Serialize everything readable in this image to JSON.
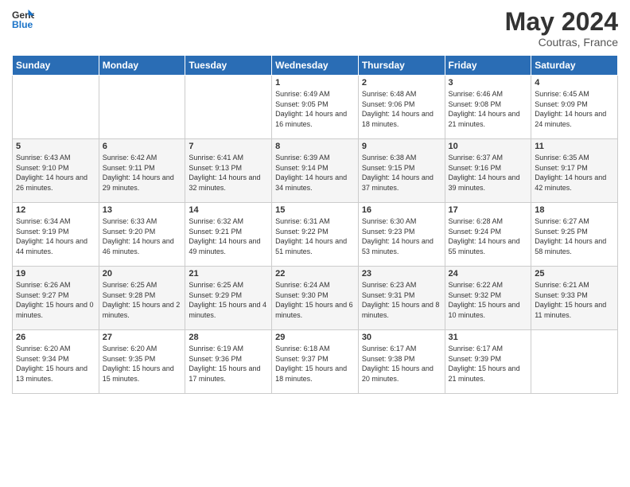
{
  "header": {
    "logo_line1": "General",
    "logo_line2": "Blue",
    "month_year": "May 2024",
    "location": "Coutras, France"
  },
  "days_of_week": [
    "Sunday",
    "Monday",
    "Tuesday",
    "Wednesday",
    "Thursday",
    "Friday",
    "Saturday"
  ],
  "weeks": [
    [
      {
        "day": "",
        "text": ""
      },
      {
        "day": "",
        "text": ""
      },
      {
        "day": "",
        "text": ""
      },
      {
        "day": "1",
        "text": "Sunrise: 6:49 AM\nSunset: 9:05 PM\nDaylight: 14 hours\nand 16 minutes."
      },
      {
        "day": "2",
        "text": "Sunrise: 6:48 AM\nSunset: 9:06 PM\nDaylight: 14 hours\nand 18 minutes."
      },
      {
        "day": "3",
        "text": "Sunrise: 6:46 AM\nSunset: 9:08 PM\nDaylight: 14 hours\nand 21 minutes."
      },
      {
        "day": "4",
        "text": "Sunrise: 6:45 AM\nSunset: 9:09 PM\nDaylight: 14 hours\nand 24 minutes."
      }
    ],
    [
      {
        "day": "5",
        "text": "Sunrise: 6:43 AM\nSunset: 9:10 PM\nDaylight: 14 hours\nand 26 minutes."
      },
      {
        "day": "6",
        "text": "Sunrise: 6:42 AM\nSunset: 9:11 PM\nDaylight: 14 hours\nand 29 minutes."
      },
      {
        "day": "7",
        "text": "Sunrise: 6:41 AM\nSunset: 9:13 PM\nDaylight: 14 hours\nand 32 minutes."
      },
      {
        "day": "8",
        "text": "Sunrise: 6:39 AM\nSunset: 9:14 PM\nDaylight: 14 hours\nand 34 minutes."
      },
      {
        "day": "9",
        "text": "Sunrise: 6:38 AM\nSunset: 9:15 PM\nDaylight: 14 hours\nand 37 minutes."
      },
      {
        "day": "10",
        "text": "Sunrise: 6:37 AM\nSunset: 9:16 PM\nDaylight: 14 hours\nand 39 minutes."
      },
      {
        "day": "11",
        "text": "Sunrise: 6:35 AM\nSunset: 9:17 PM\nDaylight: 14 hours\nand 42 minutes."
      }
    ],
    [
      {
        "day": "12",
        "text": "Sunrise: 6:34 AM\nSunset: 9:19 PM\nDaylight: 14 hours\nand 44 minutes."
      },
      {
        "day": "13",
        "text": "Sunrise: 6:33 AM\nSunset: 9:20 PM\nDaylight: 14 hours\nand 46 minutes."
      },
      {
        "day": "14",
        "text": "Sunrise: 6:32 AM\nSunset: 9:21 PM\nDaylight: 14 hours\nand 49 minutes."
      },
      {
        "day": "15",
        "text": "Sunrise: 6:31 AM\nSunset: 9:22 PM\nDaylight: 14 hours\nand 51 minutes."
      },
      {
        "day": "16",
        "text": "Sunrise: 6:30 AM\nSunset: 9:23 PM\nDaylight: 14 hours\nand 53 minutes."
      },
      {
        "day": "17",
        "text": "Sunrise: 6:28 AM\nSunset: 9:24 PM\nDaylight: 14 hours\nand 55 minutes."
      },
      {
        "day": "18",
        "text": "Sunrise: 6:27 AM\nSunset: 9:25 PM\nDaylight: 14 hours\nand 58 minutes."
      }
    ],
    [
      {
        "day": "19",
        "text": "Sunrise: 6:26 AM\nSunset: 9:27 PM\nDaylight: 15 hours\nand 0 minutes."
      },
      {
        "day": "20",
        "text": "Sunrise: 6:25 AM\nSunset: 9:28 PM\nDaylight: 15 hours\nand 2 minutes."
      },
      {
        "day": "21",
        "text": "Sunrise: 6:25 AM\nSunset: 9:29 PM\nDaylight: 15 hours\nand 4 minutes."
      },
      {
        "day": "22",
        "text": "Sunrise: 6:24 AM\nSunset: 9:30 PM\nDaylight: 15 hours\nand 6 minutes."
      },
      {
        "day": "23",
        "text": "Sunrise: 6:23 AM\nSunset: 9:31 PM\nDaylight: 15 hours\nand 8 minutes."
      },
      {
        "day": "24",
        "text": "Sunrise: 6:22 AM\nSunset: 9:32 PM\nDaylight: 15 hours\nand 10 minutes."
      },
      {
        "day": "25",
        "text": "Sunrise: 6:21 AM\nSunset: 9:33 PM\nDaylight: 15 hours\nand 11 minutes."
      }
    ],
    [
      {
        "day": "26",
        "text": "Sunrise: 6:20 AM\nSunset: 9:34 PM\nDaylight: 15 hours\nand 13 minutes."
      },
      {
        "day": "27",
        "text": "Sunrise: 6:20 AM\nSunset: 9:35 PM\nDaylight: 15 hours\nand 15 minutes."
      },
      {
        "day": "28",
        "text": "Sunrise: 6:19 AM\nSunset: 9:36 PM\nDaylight: 15 hours\nand 17 minutes."
      },
      {
        "day": "29",
        "text": "Sunrise: 6:18 AM\nSunset: 9:37 PM\nDaylight: 15 hours\nand 18 minutes."
      },
      {
        "day": "30",
        "text": "Sunrise: 6:17 AM\nSunset: 9:38 PM\nDaylight: 15 hours\nand 20 minutes."
      },
      {
        "day": "31",
        "text": "Sunrise: 6:17 AM\nSunset: 9:39 PM\nDaylight: 15 hours\nand 21 minutes."
      },
      {
        "day": "",
        "text": ""
      }
    ]
  ]
}
